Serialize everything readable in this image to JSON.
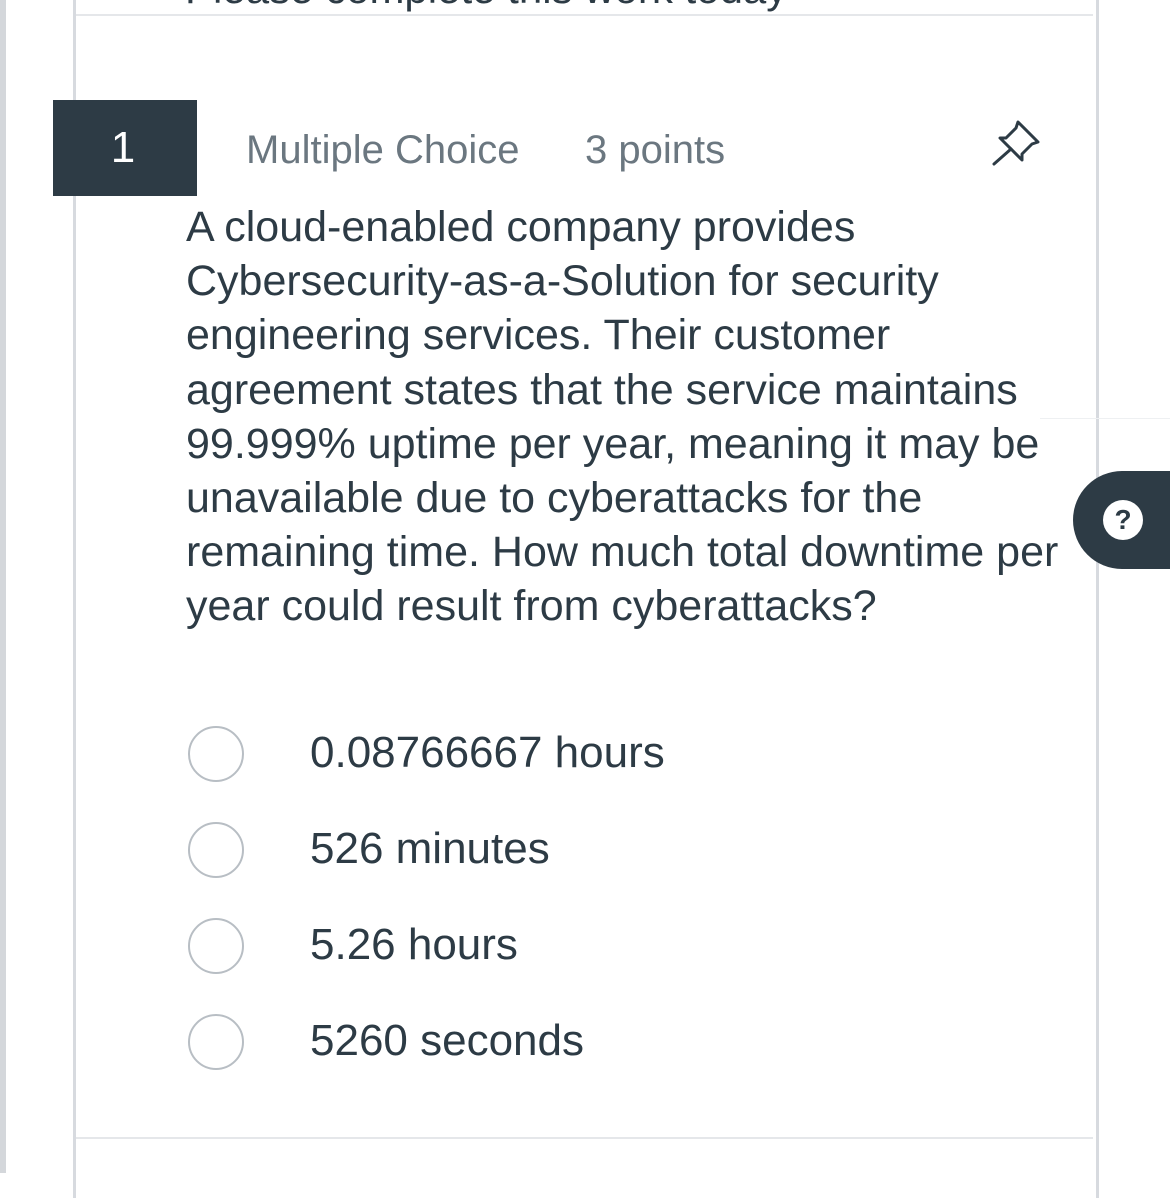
{
  "header": {
    "clipped_text": "Please complete this work today"
  },
  "question": {
    "number": "1",
    "type": "Multiple Choice",
    "points": "3 points",
    "pin_icon": "pin-icon",
    "text": "A cloud-enabled company provides Cybersecurity-as-a-Solution for security engineering services. Their customer agreement states that the service maintains 99.999% uptime per year, meaning it may be unavailable due to cyberattacks for the remaining time. How much total downtime per year could result from cyberattacks?",
    "options": [
      {
        "label": "0.08766667 hours"
      },
      {
        "label": "526 minutes"
      },
      {
        "label": "5.26 hours"
      },
      {
        "label": "5260 seconds"
      }
    ]
  },
  "help": {
    "icon": "help-icon",
    "glyph": "?"
  },
  "colors": {
    "dark": "#2d3b45",
    "muted": "#6b7780",
    "radio_border": "#b8bec4"
  }
}
